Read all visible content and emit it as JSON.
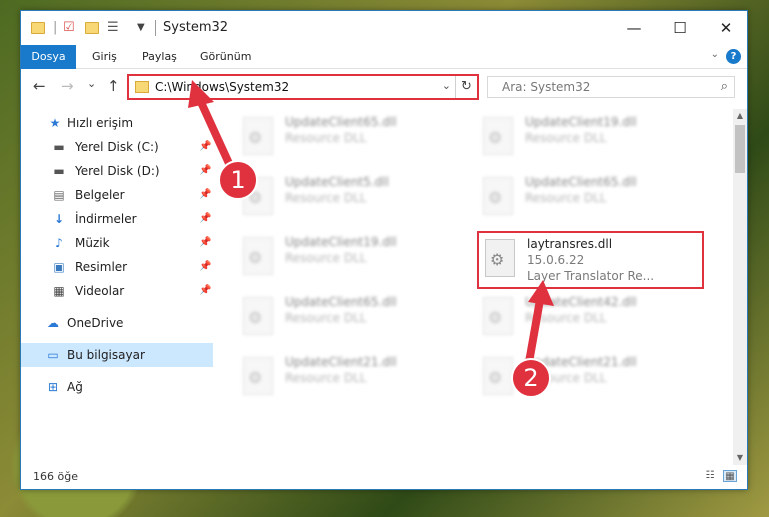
{
  "window": {
    "title": "System32",
    "minimize": "—",
    "maximize": "☐",
    "close": "✕"
  },
  "ribbon": {
    "tabs": [
      "Dosya",
      "Giriş",
      "Paylaş",
      "Görünüm"
    ],
    "help": "?"
  },
  "nav": {
    "back": "←",
    "forward": "→",
    "recent": "⌄",
    "up": "↑",
    "address": "C:\\Windows\\System32",
    "refresh": "↻",
    "search_placeholder": "Ara: System32"
  },
  "sidebar": {
    "items": [
      {
        "label": "Hızlı erişim",
        "icon": "star-icon",
        "pinned": false,
        "selected": false
      },
      {
        "label": "Yerel Disk (C:)",
        "icon": "drive-icon",
        "pinned": true,
        "selected": false
      },
      {
        "label": "Yerel Disk (D:)",
        "icon": "drive-icon",
        "pinned": true,
        "selected": false
      },
      {
        "label": "Belgeler",
        "icon": "documents-icon",
        "pinned": true,
        "selected": false
      },
      {
        "label": "İndirmeler",
        "icon": "download-icon",
        "pinned": true,
        "selected": false
      },
      {
        "label": "Müzik",
        "icon": "music-icon",
        "pinned": true,
        "selected": false
      },
      {
        "label": "Resimler",
        "icon": "pictures-icon",
        "pinned": true,
        "selected": false
      },
      {
        "label": "Videolar",
        "icon": "videos-icon",
        "pinned": true,
        "selected": false
      },
      {
        "label": "OneDrive",
        "icon": "cloud-icon",
        "pinned": false,
        "selected": false
      },
      {
        "label": "Bu bilgisayar",
        "icon": "computer-icon",
        "pinned": false,
        "selected": true
      },
      {
        "label": "Ağ",
        "icon": "network-icon",
        "pinned": false,
        "selected": false
      }
    ]
  },
  "files": [
    {
      "name": "UpdateClient65.dll",
      "type": "Resource DLL"
    },
    {
      "name": "UpdateClient19.dll",
      "type": "Resource DLL"
    },
    {
      "name": "UpdateClient5.dll",
      "type": "Resource DLL"
    },
    {
      "name": "UpdateClient65.dll",
      "type": "Resource DLL"
    },
    {
      "name": "UpdateClient19.dll",
      "type": "Resource DLL"
    },
    {
      "name": "laytransres.dll",
      "version": "15.0.6.22",
      "type": "Layer Translator Re..."
    },
    {
      "name": "UpdateClient65.dll",
      "type": "Resource DLL"
    },
    {
      "name": "UpdateClient42.dll",
      "type": "Resource DLL"
    },
    {
      "name": "UpdateClient21.dll",
      "type": "Resource DLL"
    },
    {
      "name": "UpdateClient21.dll",
      "type": "Resource DLL"
    }
  ],
  "status": {
    "count": "166 öğe"
  },
  "annotations": {
    "step1": "1",
    "step2": "2",
    "accent": "#e0313f"
  }
}
